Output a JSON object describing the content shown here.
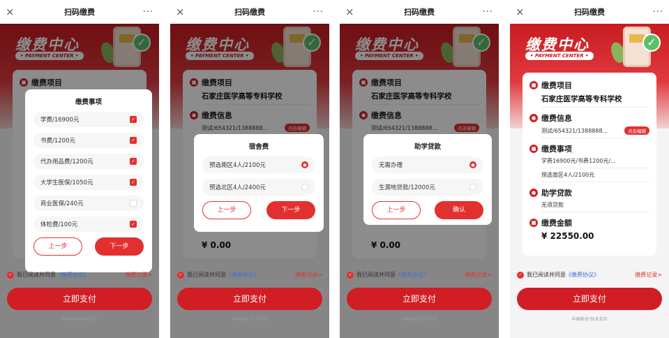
{
  "common": {
    "window_title": "扫码缴费",
    "close_glyph": "×",
    "more_glyph": "···",
    "brand_title": "缴费中心",
    "brand_subtitle": "• PAYMENT CENTER •",
    "agree_prefix": "我已阅读并同意",
    "agree_link": "《缴费协议》",
    "record_link": "缴费记录>",
    "pay_button": "立即支付",
    "support_text": "中国移动\"技术支持"
  },
  "form": {
    "item_label": "缴费项目",
    "school": "石家庄医学高等专科学校",
    "info_label": "缴费信息",
    "info_value": "测试/654321/1388888...",
    "edit_button": "点击编辑",
    "fees_label": "缴费事项",
    "fees_value": "学费16900元/书费1200元/...",
    "dorm_value": "预选南区4人/2100元",
    "loan_label": "助学贷款",
    "loan_value": "无须贷款",
    "amount_label": "缴费金额",
    "amount_zero": "¥ 0.00",
    "amount_total": "¥ 22550.00"
  },
  "screen1_modal": {
    "title": "缴费事项",
    "items": [
      {
        "label": "学费/16900元",
        "checked": true
      },
      {
        "label": "书费/1200元",
        "checked": true
      },
      {
        "label": "代办用品费/1200元",
        "checked": true
      },
      {
        "label": "大学生医保/1050元",
        "checked": true
      },
      {
        "label": "商业医保/240元",
        "checked": false
      },
      {
        "label": "体检费/100元",
        "checked": true
      }
    ],
    "prev": "上一步",
    "next": "下一步"
  },
  "screen2_modal": {
    "title": "宿舍费",
    "items": [
      {
        "label": "预选南区4人/2100元",
        "selected": true
      },
      {
        "label": "预选北区4人/2400元",
        "selected": false
      }
    ],
    "prev": "上一步",
    "next": "下一步"
  },
  "screen3_modal": {
    "title": "助学贷款",
    "items": [
      {
        "label": "无需办理",
        "selected": true
      },
      {
        "label": "生源地贷款/12000元",
        "selected": false
      }
    ],
    "prev": "上一步",
    "confirm": "确认"
  },
  "colors": {
    "accent": "#e2302f",
    "brand": "#c81b22",
    "link": "#3d6fd4"
  }
}
